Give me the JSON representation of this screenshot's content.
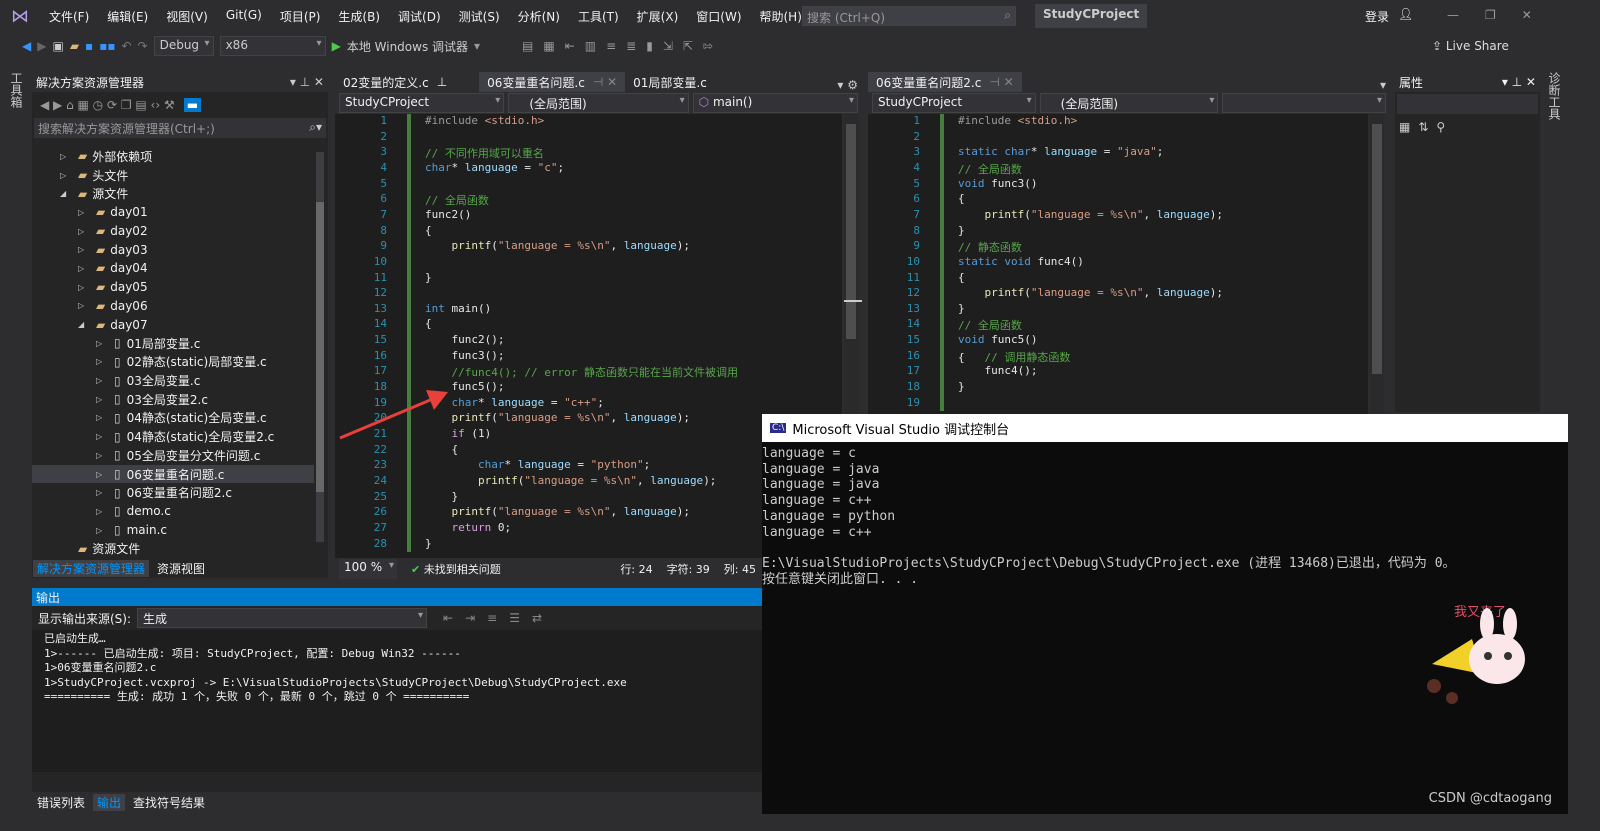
{
  "menu": {
    "items": [
      "文件(F)",
      "编辑(E)",
      "视图(V)",
      "Git(G)",
      "项目(P)",
      "生成(B)",
      "调试(D)",
      "测试(S)",
      "分析(N)",
      "工具(T)",
      "扩展(X)",
      "窗口(W)",
      "帮助(H)"
    ],
    "search_placeholder": "搜索 (Ctrl+Q)",
    "project": "StudyCProject",
    "login": "登录"
  },
  "toolbar": {
    "config": "Debug",
    "platform": "x86",
    "run": "本地 Windows 调试器",
    "liveshare": "Live Share"
  },
  "left_strip": "工具箱",
  "right_strip": "诊断工具",
  "solution": {
    "title": "解决方案资源管理器",
    "search_placeholder": "搜索解决方案资源管理器(Ctrl+;)",
    "items": [
      {
        "label": "外部依赖项",
        "depth": 1,
        "type": "ref",
        "exp": "▷"
      },
      {
        "label": "头文件",
        "depth": 1,
        "type": "folder",
        "exp": "▷"
      },
      {
        "label": "源文件",
        "depth": 1,
        "type": "folder",
        "exp": "◢"
      },
      {
        "label": "day01",
        "depth": 2,
        "type": "folder",
        "exp": "▷"
      },
      {
        "label": "day02",
        "depth": 2,
        "type": "folder",
        "exp": "▷"
      },
      {
        "label": "day03",
        "depth": 2,
        "type": "folder",
        "exp": "▷"
      },
      {
        "label": "day04",
        "depth": 2,
        "type": "folder",
        "exp": "▷"
      },
      {
        "label": "day05",
        "depth": 2,
        "type": "folder",
        "exp": "▷"
      },
      {
        "label": "day06",
        "depth": 2,
        "type": "folder",
        "exp": "▷"
      },
      {
        "label": "day07",
        "depth": 2,
        "type": "folder",
        "exp": "◢"
      },
      {
        "label": "01局部变量.c",
        "depth": 3,
        "type": "file",
        "exp": "▷"
      },
      {
        "label": "02静态(static)局部变量.c",
        "depth": 3,
        "type": "file",
        "exp": "▷"
      },
      {
        "label": "03全局变量.c",
        "depth": 3,
        "type": "file",
        "exp": "▷"
      },
      {
        "label": "03全局变量2.c",
        "depth": 3,
        "type": "file",
        "exp": "▷"
      },
      {
        "label": "04静态(static)全局变量.c",
        "depth": 3,
        "type": "file",
        "exp": "▷"
      },
      {
        "label": "04静态(static)全局变量2.c",
        "depth": 3,
        "type": "file",
        "exp": "▷"
      },
      {
        "label": "05全局变量分文件问题.c",
        "depth": 3,
        "type": "file",
        "exp": "▷"
      },
      {
        "label": "06变量重名问题.c",
        "depth": 3,
        "type": "file",
        "exp": "▷",
        "selected": true
      },
      {
        "label": "06变量重名问题2.c",
        "depth": 3,
        "type": "file",
        "exp": "▷"
      },
      {
        "label": "demo.c",
        "depth": 3,
        "type": "file",
        "exp": "▷"
      },
      {
        "label": "main.c",
        "depth": 3,
        "type": "file",
        "exp": "▷"
      },
      {
        "label": "资源文件",
        "depth": 1,
        "type": "folder",
        "exp": ""
      }
    ],
    "tabs": [
      "解决方案资源管理器",
      "资源视图"
    ]
  },
  "editor_left": {
    "tabs": [
      "02变量的定义.c",
      "06变量重名问题.c",
      "01局部变量.c"
    ],
    "nav": [
      "StudyCProject",
      "(全局范围)",
      "main()"
    ],
    "lines": [
      "#include <stdio.h>",
      "",
      "// 不同作用域可以重名",
      "char* language = \"c\";",
      "",
      "// 全局函数",
      "func2()",
      "{",
      "    printf(\"language = %s\\n\", language);",
      "",
      "}",
      "",
      "int main()",
      "{",
      "    func2();",
      "    func3();",
      "    //func4(); // error 静态函数只能在当前文件被调用",
      "    func5();",
      "    char* language = \"c++\";",
      "    printf(\"language = %s\\n\", language);",
      "    if (1)",
      "    {",
      "        char* language = \"python\";",
      "        printf(\"language = %s\\n\", language);",
      "    }",
      "    printf(\"language = %s\\n\", language);",
      "    return 0;",
      "}"
    ],
    "status": {
      "zoom": "100 %",
      "issues": "未找到相关问题",
      "row": "行: 24",
      "char": "字符: 39",
      "col": "列: 45"
    }
  },
  "editor_right": {
    "tabs": [
      "06变量重名问题2.c"
    ],
    "nav": [
      "StudyCProject",
      "(全局范围)",
      ""
    ],
    "lines": [
      "#include <stdio.h>",
      "",
      "static char* language = \"java\";",
      "// 全局函数",
      "void func3()",
      "{",
      "    printf(\"language = %s\\n\", language);",
      "}",
      "// 静态函数",
      "static void func4()",
      "{",
      "    printf(\"language = %s\\n\", language);",
      "}",
      "// 全局函数",
      "void func5()",
      "{   // 调用静态函数",
      "    func4();",
      "}",
      ""
    ]
  },
  "properties": {
    "title": "属性"
  },
  "output": {
    "title": "输出",
    "source_label": "显示输出来源(S):",
    "source": "生成",
    "lines": [
      "已启动生成…",
      "1>------ 已启动生成: 项目: StudyCProject, 配置: Debug Win32 ------",
      "1>06变量重名问题2.c",
      "1>StudyCProject.vcxproj -> E:\\VisualStudioProjects\\StudyCProject\\Debug\\StudyCProject.exe",
      "========== 生成: 成功 1 个，失败 0 个，最新 0 个，跳过 0 个 =========="
    ],
    "tabs": [
      "错误列表",
      "输出",
      "查找符号结果"
    ]
  },
  "console": {
    "title": "Microsoft Visual Studio 调试控制台",
    "lines": [
      "language = c",
      "language = java",
      "language = java",
      "language = c++",
      "language = python",
      "language = c++",
      "",
      "E:\\VisualStudioProjects\\StudyCProject\\Debug\\StudyCProject.exe (进程 13468)已退出，代码为 0。",
      "按任意键关闭此窗口. . ."
    ],
    "sticker_text": "我又来了",
    "watermark": "CSDN @cdtaogang"
  },
  "colors": {
    "accent": "#007acc",
    "arrow": "#e8403a"
  }
}
